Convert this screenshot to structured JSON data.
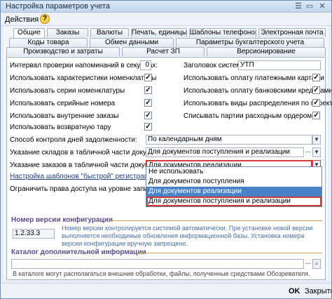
{
  "window": {
    "title": "Настройка параметров учета"
  },
  "toolbar": {
    "actions_label": "Действия ▾",
    "help_label": "?"
  },
  "tabs_row1": [
    "Общие",
    "Заказы",
    "Валюты",
    "Печать, единицы",
    "Шаблоны телефонов",
    "Электронная почта"
  ],
  "tabs_row2": [
    "Коды товара",
    "Обмен данными",
    "Параметры бухгалтерского учета"
  ],
  "tabs_row3": [
    "Производство и затраты",
    "Расчет ЗП",
    "Версионирование"
  ],
  "left_settings": {
    "reminder_interval_label": "Интервал проверки напоминаний в секундах:",
    "reminder_interval_value": "0",
    "items": [
      {
        "label": "Использовать характеристики номенклатуры",
        "checked": true
      },
      {
        "label": "Использовать серии номенклатуры",
        "checked": true
      },
      {
        "label": "Использовать серийные номера",
        "checked": true
      },
      {
        "label": "Использовать внутренние заказы",
        "checked": true
      },
      {
        "label": "Использовать возвратную тару",
        "checked": true
      }
    ]
  },
  "right_settings": {
    "system_title_label": "Заголовок системы:",
    "system_title_value": "УТП",
    "items": [
      {
        "label": "Использовать оплату платежными картами",
        "checked": true
      },
      {
        "label": "Использовать оплату банковскими кредитами",
        "checked": true
      },
      {
        "label": "Использовать виды распределения по проектам",
        "checked": true
      },
      {
        "label": "Списывать партии расходным ордером",
        "checked": true
      }
    ]
  },
  "debt_control": {
    "label": "Способ контроля дней задолженности:",
    "value": "По календарным дням"
  },
  "warehouses": {
    "label": "Указание складов в табличной части документов:",
    "value": "Для документов поступления и реализации"
  },
  "orders": {
    "label": "Указание заказов в табличной части документов:",
    "value": "Для документов реализации"
  },
  "links": {
    "quick_selection": "Настройка шаблонов \"быстрой\" регистрации нового",
    "restrict_access": "Ограничить права доступа на уровне записей"
  },
  "dropdown": {
    "options": [
      "Не использовать",
      "Для документов поступления",
      "Для документов реализации",
      "Для документов поступления и реализации"
    ],
    "selected_index": 2
  },
  "config_version": {
    "section_title": "Номер версии конфигурации",
    "value": "1.2.33.3",
    "hint": "Номер версии контролируется системой автоматически. При установке новой версии выполняется необходимые обновления информационной базы. Установка номера версии конфигурации вручную запрещено."
  },
  "catalog": {
    "section_title": "Каталог дополнительной информации",
    "value": "",
    "hint": "В каталоге могут располагаться внешние обработки, файлы, полученные средствами Обозревателя."
  },
  "buttons": {
    "ok": "OK",
    "close": "Закрыть"
  },
  "colors": {
    "accent": "#4a82c8",
    "section_title": "#5a4a8a",
    "highlight_border": "#d23a3a"
  }
}
